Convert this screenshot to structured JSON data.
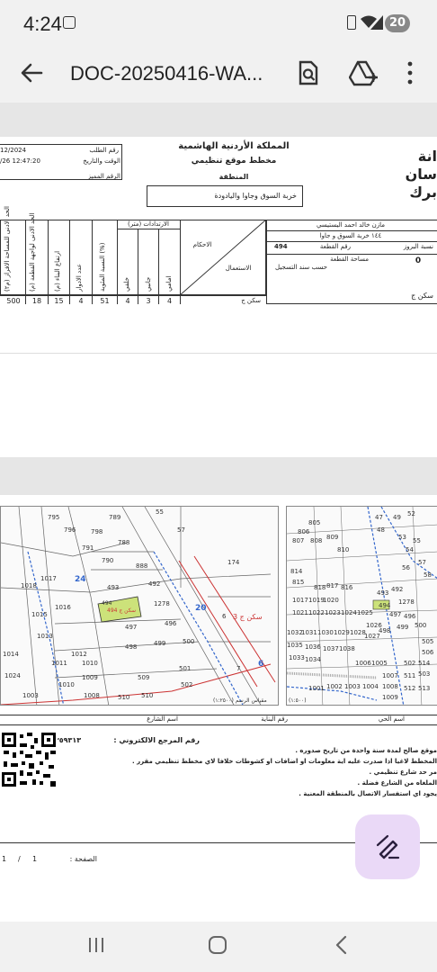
{
  "status_bar": {
    "time": "4:24",
    "notification_count": "20"
  },
  "app_bar": {
    "title": "DOC-20250416-WA..."
  },
  "document": {
    "header": {
      "kingdom": "المملكة الأردنية الهاشمية",
      "doc_type": "مخطط موقع تنظيمي",
      "region_label": "المنطقة",
      "region_value": "خربة السوق وجاوا واليادودة",
      "request_no_label": "رقم الطلب",
      "request_no_value": "12/2024",
      "datetime_label": "الوقت والتاريخ",
      "datetime_value": "/26 12:47:20",
      "serial_label": "الرقم المميز",
      "left_logo_lines": [
        "انة",
        "سان",
        "برك"
      ]
    },
    "owner": {
      "name": "مازن خالد احمد اليستيسي",
      "village": "١٤٤ خربة السوق و جاوا",
      "plot_label": "رقم القطعة",
      "plot_value": "494",
      "basin_label": "مساحة القطعة",
      "basin_value": "0",
      "reg_label": "حسب سند التسجيل",
      "build_label": "نسبة البروز",
      "use_label": "الاستعمال",
      "use_value": "سكن ج",
      "rules_label": "الاحكام"
    },
    "setbacks": {
      "title": "الارتدادات (متر)",
      "columns": [
        "امامي",
        "جانبي",
        "خلفي",
        "النسبة المئوية (%)",
        "عدد الادوار",
        "ارتفاع البناء (م)",
        "الحد الادنى لواجهة القطعة (م)",
        "الحد الادنى للمساحة الافراز (م٢)"
      ],
      "values": [
        "4",
        "3",
        "4",
        "51",
        "4",
        "15",
        "18",
        "500"
      ]
    },
    "maps": {
      "scale_label": "مقياس الرسم (١:٢٥٠٠)",
      "scale_label_right": "(١:٥٠٠)",
      "street_fields": [
        "اسم الحي",
        "رقم البناية",
        "اسم الشارع",
        "اسم الشارع"
      ],
      "zone_label": "سكن ج 3",
      "plot_label": "سكن ج 494",
      "lots_left": [
        "795",
        "796",
        "789",
        "55",
        "798",
        "791",
        "788",
        "57",
        "790",
        "888",
        "1018",
        "1017",
        "493",
        "492",
        "174",
        "1278",
        "1015",
        "1016",
        "497",
        "496",
        "1014",
        "1013",
        "1012",
        "498",
        "499",
        "500",
        "1011",
        "1010",
        "509",
        "1009",
        "502",
        "501",
        "510",
        "510",
        "1003",
        "1008",
        "1024",
        "1010",
        "24",
        "20",
        "6",
        "7",
        "6",
        "494"
      ],
      "lots_right": [
        "805",
        "806",
        "807",
        "808",
        "809",
        "810",
        "47",
        "49",
        "52",
        "48",
        "53",
        "55",
        "54",
        "57",
        "56",
        "58",
        "814",
        "815",
        "818",
        "817",
        "816",
        "493",
        "492",
        "1278",
        "1017",
        "1019",
        "1020",
        "494",
        "497",
        "496",
        "1021",
        "1022",
        "1023",
        "1024",
        "1025",
        "500",
        "499",
        "498",
        "1032",
        "1031",
        "1030",
        "1029",
        "1028",
        "1027",
        "1026",
        "505",
        "506",
        "1035",
        "1036",
        "1037",
        "1038",
        "1033",
        "1034",
        "1006",
        "1005",
        "502",
        "503",
        "511",
        "512",
        "513",
        "514",
        "1007",
        "1008",
        "1009",
        "1004",
        "1003",
        "1002",
        "1001"
      ]
    },
    "footer": {
      "ref_label": "رقم المرجع الالكتروني :",
      "ref_value": "٠٠٠٤٢٠٢٤١٢٣٥٩٣١٣",
      "notes": [
        "موقع صالح لمدة سنة واحدة من تاريخ صدوره .",
        "المخطط لاغيا اذا صدرت عليه اية معلومات او اضافات او كشوطات خلافا لاي مخطط تنظيمي مقرر .",
        "مر حد شارع تنظيمي .",
        "الملغاه من الشارع فضلة .",
        "يجود اي استفسار الاتصال بالمنطقة المعنية ."
      ],
      "page_label": "الصفحة :",
      "page_value": "1",
      "page_sep": "/",
      "page_total": "1"
    }
  }
}
